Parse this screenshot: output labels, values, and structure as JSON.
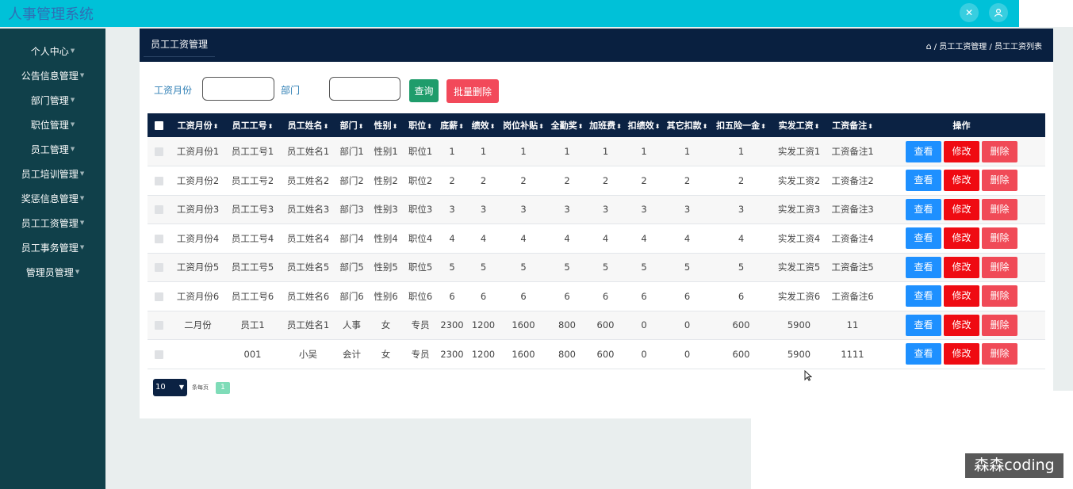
{
  "app": {
    "title": "人事管理系统"
  },
  "sidebar": {
    "items": [
      {
        "label": "个人中心"
      },
      {
        "label": "公告信息管理"
      },
      {
        "label": "部门管理"
      },
      {
        "label": "职位管理"
      },
      {
        "label": "员工管理"
      },
      {
        "label": "员工培训管理"
      },
      {
        "label": "奖惩信息管理"
      },
      {
        "label": "员工工资管理"
      },
      {
        "label": "员工事务管理"
      },
      {
        "label": "管理员管理"
      }
    ]
  },
  "header": {
    "title": "员工工资管理",
    "breadcrumb": "/ 员工工资管理 / 员工工资列表"
  },
  "search": {
    "month_label": "工资月份",
    "month_value": "",
    "dept_label": "部门",
    "dept_value": "",
    "query_button": "查询",
    "batch_delete_button": "批量删除"
  },
  "table": {
    "columns": [
      "工资月份",
      "员工工号",
      "员工姓名",
      "部门",
      "性别",
      "职位",
      "底薪",
      "绩效",
      "岗位补贴",
      "全勤奖",
      "加班费",
      "扣绩效",
      "其它扣款",
      "扣五险一金",
      "实发工资",
      "工资备注",
      "操作"
    ],
    "actions": {
      "view": "查看",
      "edit": "修改",
      "delete": "删除"
    },
    "rows": [
      [
        "工资月份1",
        "员工工号1",
        "员工姓名1",
        "部门1",
        "性别1",
        "职位1",
        "1",
        "1",
        "1",
        "1",
        "1",
        "1",
        "1",
        "1",
        "实发工资1",
        "工资备注1"
      ],
      [
        "工资月份2",
        "员工工号2",
        "员工姓名2",
        "部门2",
        "性别2",
        "职位2",
        "2",
        "2",
        "2",
        "2",
        "2",
        "2",
        "2",
        "2",
        "实发工资2",
        "工资备注2"
      ],
      [
        "工资月份3",
        "员工工号3",
        "员工姓名3",
        "部门3",
        "性别3",
        "职位3",
        "3",
        "3",
        "3",
        "3",
        "3",
        "3",
        "3",
        "3",
        "实发工资3",
        "工资备注3"
      ],
      [
        "工资月份4",
        "员工工号4",
        "员工姓名4",
        "部门4",
        "性别4",
        "职位4",
        "4",
        "4",
        "4",
        "4",
        "4",
        "4",
        "4",
        "4",
        "实发工资4",
        "工资备注4"
      ],
      [
        "工资月份5",
        "员工工号5",
        "员工姓名5",
        "部门5",
        "性别5",
        "职位5",
        "5",
        "5",
        "5",
        "5",
        "5",
        "5",
        "5",
        "5",
        "实发工资5",
        "工资备注5"
      ],
      [
        "工资月份6",
        "员工工号6",
        "员工姓名6",
        "部门6",
        "性别6",
        "职位6",
        "6",
        "6",
        "6",
        "6",
        "6",
        "6",
        "6",
        "6",
        "实发工资6",
        "工资备注6"
      ],
      [
        "二月份",
        "员工1",
        "员工姓名1",
        "人事",
        "女",
        "专员",
        "2300",
        "1200",
        "1600",
        "800",
        "600",
        "0",
        "0",
        "600",
        "5900",
        "11"
      ],
      [
        "",
        "001",
        "小吴",
        "会计",
        "女",
        "专员",
        "2300",
        "1200",
        "1600",
        "800",
        "600",
        "0",
        "0",
        "600",
        "5900",
        "1111"
      ]
    ]
  },
  "pagination": {
    "page_size": "10",
    "per_page_label": "条每页",
    "current_page": "1"
  },
  "watermark": "森森coding"
}
